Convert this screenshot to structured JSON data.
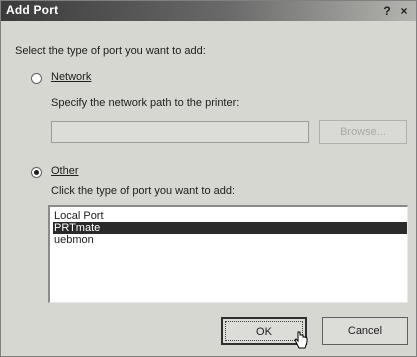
{
  "window": {
    "title": "Add Port",
    "help_button": "?",
    "close_button": "×"
  },
  "prompt": "Select the type of port you want to add:",
  "network": {
    "label": "Network",
    "selected": false,
    "hint": "Specify the network path to the printer:",
    "path_value": "",
    "browse_label": "Browse..."
  },
  "other": {
    "label": "Other",
    "selected": true,
    "hint": "Click the type of port you want to add:",
    "ports": [
      {
        "label": "Local Port",
        "selected": false
      },
      {
        "label": "PRTmate",
        "selected": true
      },
      {
        "label": "uebmon",
        "selected": false
      }
    ]
  },
  "buttons": {
    "ok_label": "OK",
    "cancel_label": "Cancel"
  }
}
